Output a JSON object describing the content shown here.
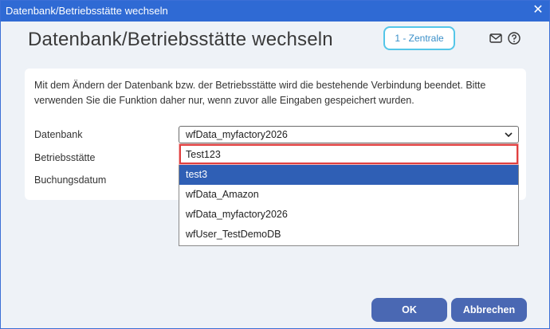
{
  "window": {
    "title": "Datenbank/Betriebsstätte wechseln"
  },
  "header": {
    "title": "Datenbank/Betriebsstätte wechseln",
    "badge": "1 - Zentrale",
    "icons": [
      "mail-icon",
      "help-icon"
    ]
  },
  "form": {
    "info": "Mit dem Ändern der Datenbank bzw. der Betriebsstätte wird die bestehende Verbindung beendet. Bitte verwenden Sie die Funktion daher nur, wenn zuvor alle Eingaben gespeichert wurden.",
    "datenbank_label": "Datenbank",
    "datenbank_value": "wfData_myfactory2026",
    "betriebsstaette_label": "Betriebsstätte",
    "buchungsdatum_label": "Buchungsdatum"
  },
  "dropdown": {
    "options": [
      "Test123",
      "test3",
      "wfData_Amazon",
      "wfData_myfactory2026",
      "wfUser_TestDemoDB"
    ],
    "selected": "test3",
    "highlighted": "Test123"
  },
  "buttons": {
    "ok": "OK",
    "cancel": "Abbrechen"
  },
  "colors": {
    "titlebar": "#2f6ad4",
    "badge_border": "#54c6e8",
    "selected_option": "#2f5fb5",
    "highlight_border": "#e04040",
    "button": "#4a68b3"
  }
}
